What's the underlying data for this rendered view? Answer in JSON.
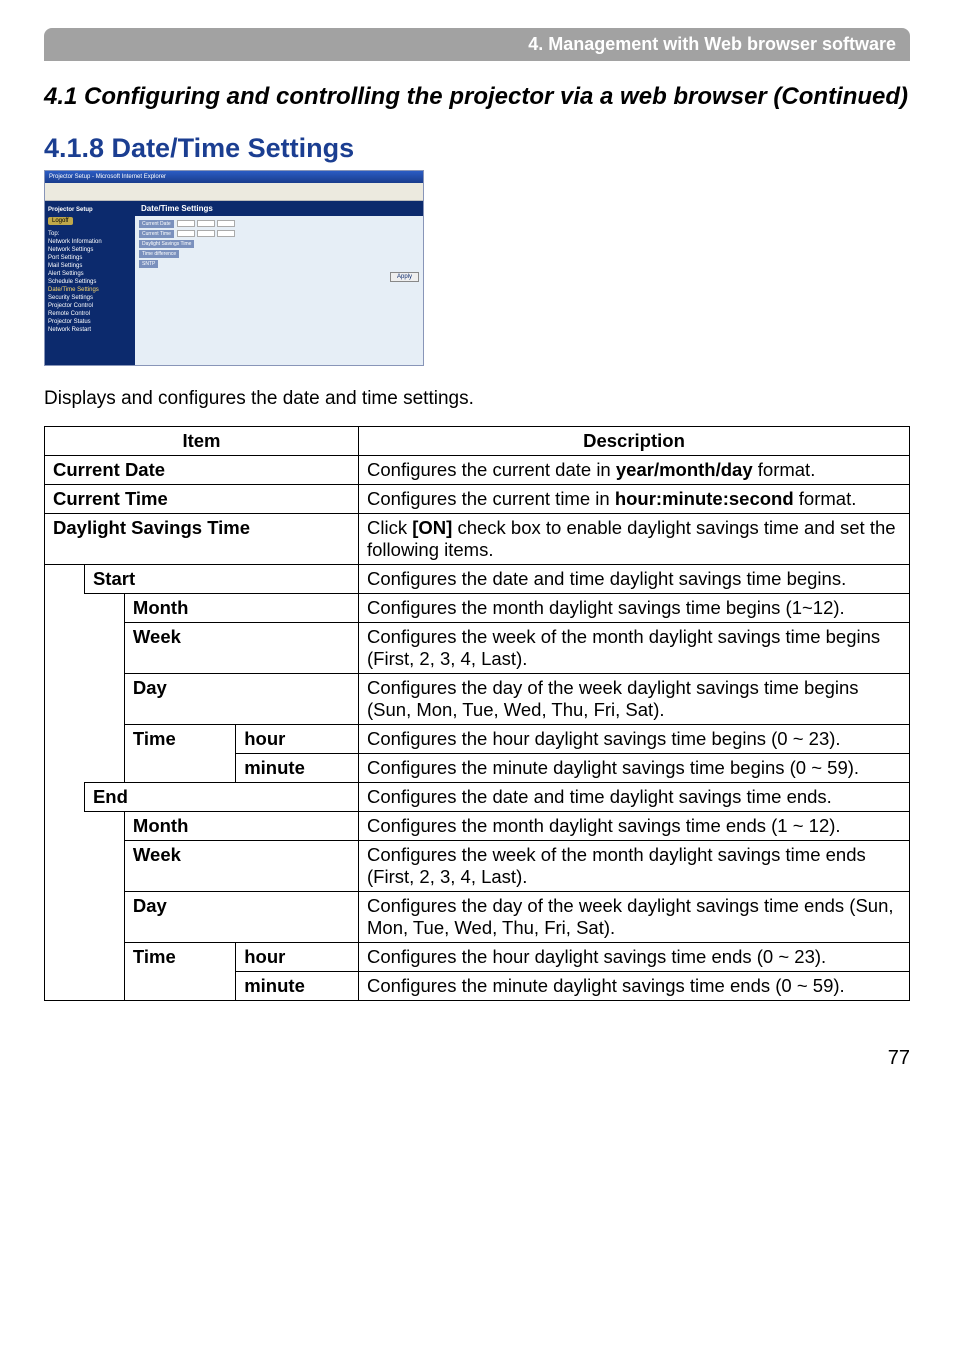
{
  "chapter_title": "4. Management with Web browser software",
  "section_header": "4.1 Configuring and controlling the projector via a web browser (Continued)",
  "subheader": "4.1.8 Date/Time Settings",
  "intro_text": "Displays and configures the date and time settings.",
  "table": {
    "head_item": "Item",
    "head_desc": "Description"
  },
  "rows": {
    "current_date": {
      "label": "Current Date",
      "desc_pre": "Configures the current date in ",
      "desc_bold": "year/month/day",
      "desc_post": " format."
    },
    "current_time": {
      "label": "Current Time",
      "desc_pre": "Configures the current time in ",
      "desc_bold": "hour:minute:second",
      "desc_post": " format."
    },
    "dst": {
      "label": "Daylight Savings Time",
      "desc_pre": "Click ",
      "desc_bold": "[ON]",
      "desc_post": " check box to enable daylight savings time and set the following items."
    },
    "start": {
      "label": "Start",
      "desc": "Configures the date and time daylight savings time begins."
    },
    "start_month": {
      "label": "Month",
      "desc": "Configures the month daylight savings time begins (1~12)."
    },
    "start_week": {
      "label": "Week",
      "desc": "Configures the week of the month daylight savings time begins (First, 2, 3, 4, Last)."
    },
    "start_day": {
      "label": "Day",
      "desc": "Configures the day of the week daylight savings time begins (Sun, Mon, Tue, Wed, Thu, Fri, Sat)."
    },
    "start_time": {
      "label": "Time"
    },
    "start_hour": {
      "label": "hour",
      "desc": "Configures the hour daylight savings time begins (0 ~ 23)."
    },
    "start_minute": {
      "label": "minute",
      "desc": "Configures the minute daylight savings time begins (0 ~ 59)."
    },
    "end": {
      "label": "End",
      "desc": "Configures the date and time daylight savings time ends."
    },
    "end_month": {
      "label": "Month",
      "desc": "Configures the month daylight savings time ends (1 ~ 12)."
    },
    "end_week": {
      "label": "Week",
      "desc": "Configures the week of the month daylight savings time ends (First, 2, 3, 4, Last)."
    },
    "end_day": {
      "label": "Day",
      "desc": "Configures the day of the week daylight savings time ends (Sun, Mon, Tue, Wed, Thu, Fri, Sat)."
    },
    "end_time": {
      "label": "Time"
    },
    "end_hour": {
      "label": "hour",
      "desc": "Configures the hour daylight savings time ends (0 ~ 23)."
    },
    "end_minute": {
      "label": "minute",
      "desc": "Configures the minute daylight savings time ends (0 ~ 59)."
    }
  },
  "screenshot": {
    "titlebar": "Projector Setup - Microsoft Internet Explorer",
    "main_title": "Date/Time Settings",
    "side_title": "Projector Setup",
    "logoff": "Logoff",
    "side_items": [
      "Top:",
      "Network Information",
      "Network Settings",
      "Port Settings",
      "Mail Settings",
      "Alert Settings",
      "Schedule Settings",
      "Date/Time Settings",
      "Security Settings",
      "Projector Control",
      "Remote Control",
      "Projector Status",
      "Network Restart"
    ],
    "apply": "Apply"
  },
  "page_number": "77"
}
